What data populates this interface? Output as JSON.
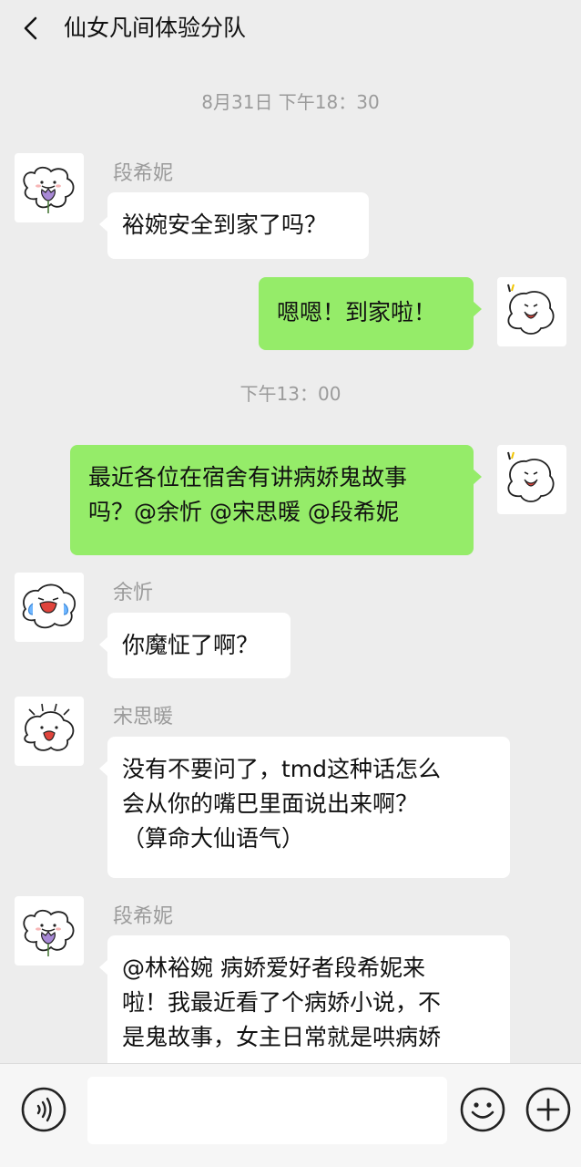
{
  "header": {
    "title": "仙女凡间体验分队"
  },
  "timestamps": [
    "8月31日 下午18：30",
    "下午13：00"
  ],
  "messages": [
    {
      "sender": "段希妮",
      "text": "裕婉安全到家了吗？",
      "side": "left"
    },
    {
      "sender": "",
      "text": "嗯嗯！到家啦！",
      "side": "right"
    },
    {
      "sender": "",
      "lines": [
        "最近各位在宿舍有讲病娇鬼故事",
        "吗？@余忻 @宋思暖 @段希妮"
      ],
      "side": "right"
    },
    {
      "sender": "余忻",
      "text": "你魔怔了啊？",
      "side": "left"
    },
    {
      "sender": "宋思暖",
      "lines": [
        "没有不要问了，tmd这种话怎么",
        "会从你的嘴巴里面说出来啊？",
        "（算命大仙语气）"
      ],
      "side": "left"
    },
    {
      "sender": "段希妮",
      "lines": [
        "@林裕婉 病娇爱好者段希妮来",
        "啦！我最近看了个病娇小说，不",
        "是鬼故事，女主日常就是哄病娇"
      ],
      "side": "left"
    }
  ],
  "input": {
    "placeholder": "",
    "value": ""
  },
  "icons": {
    "back": "chevron-left-icon",
    "voice": "voice-icon",
    "emoji": "emoji-icon",
    "plus": "plus-icon",
    "avatar_tulip": "tulip-character-avatar",
    "avatar_shout": "shouting-character-avatar",
    "avatar_cry": "crying-character-avatar",
    "avatar_shock": "shocked-character-avatar"
  },
  "colors": {
    "background": "#ededed",
    "bubble_in": "#ffffff",
    "bubble_out": "#95ec69",
    "meta_text": "#9b9b9b"
  }
}
